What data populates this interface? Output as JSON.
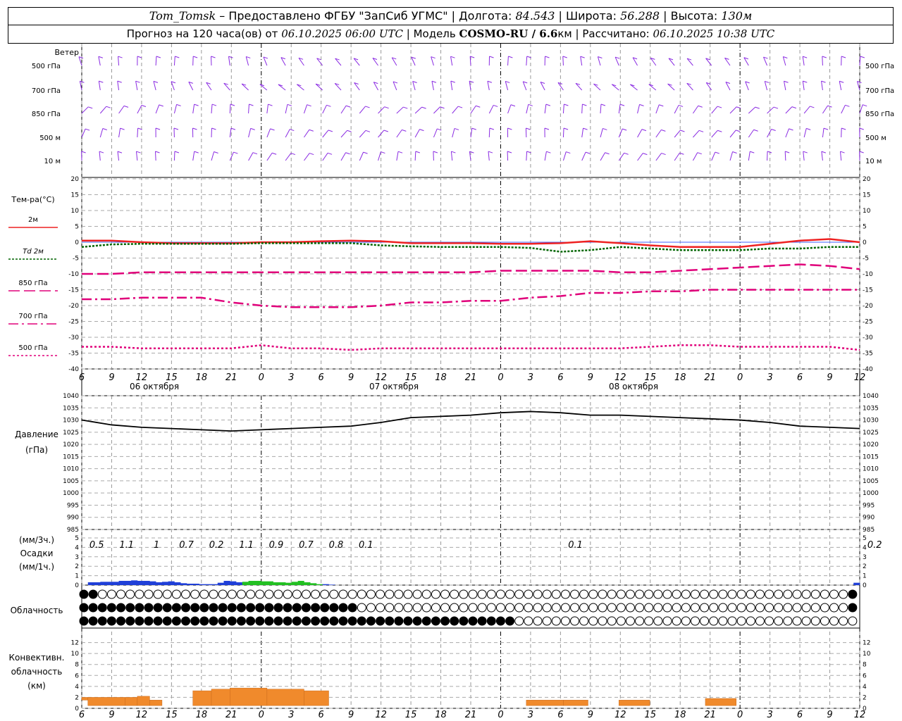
{
  "header": {
    "station": "Tom_Tomsk",
    "provider": "– Предоставлено ФГБУ \"ЗапСиб УГМС\"",
    "lon_label": "Долгота:",
    "lon": "84.543",
    "lat_label": "Широта:",
    "lat": "56.288",
    "alt_label": "Высота:",
    "alt": "130м",
    "forecast_label": "Прогноз на 120 часа(ов) от",
    "forecast_start": "06.10.2025 06:00 UTC",
    "model_label": "Модель",
    "model": "COSMO-RU / 6.6",
    "model_unit": "км",
    "calc_label": "Рассчитано:",
    "calc_time": "06.10.2025 10:38 UTC"
  },
  "labels": {
    "wind": "Ветер",
    "wind_levels": [
      "500 гПа",
      "700 гПа",
      "850 гПа",
      "500 м",
      "10 м"
    ],
    "temp": "Тем-ра(°С)",
    "pressure1": "Давление",
    "pressure2": "(гПа)",
    "precip1": "(мм/3ч.)",
    "precip2": "Осадки",
    "precip3": "(мм/1ч.)",
    "cloud": "Облачность",
    "conv1": "Конвективн.",
    "conv2": "облачность",
    "conv3": "(км)"
  },
  "colors": {
    "wind": "#8a2be2",
    "t2m": "#ee2222",
    "td2m": "#006400",
    "t850": "#e0007a",
    "t700": "#e0007a",
    "t500": "#e0007a",
    "pressure": "#000000",
    "rain": "#1f3fd8",
    "rain2": "#22c022",
    "conv": "#f08a2c"
  },
  "chart_data": {
    "type": "line",
    "x_ticks": [
      "6",
      "9",
      "12",
      "15",
      "18",
      "21",
      "0",
      "3",
      "6",
      "9",
      "12",
      "15",
      "18",
      "21",
      "0",
      "3",
      "6",
      "9",
      "12",
      "15",
      "18",
      "21",
      "0",
      "3",
      "6",
      "9",
      "12"
    ],
    "date_labels": [
      "06 октября",
      "07 октября",
      "08 октября"
    ],
    "temperature": {
      "ylim": [
        -40,
        20
      ],
      "yticks": [
        20,
        15,
        10,
        5,
        0,
        -5,
        -10,
        -15,
        -20,
        -25,
        -30,
        -35,
        -40
      ],
      "series": [
        {
          "name": "2м",
          "values": [
            0.5,
            0.5,
            0,
            -0.3,
            -0.3,
            -0.3,
            0,
            0,
            0.3,
            0.5,
            0.3,
            -0.3,
            -0.3,
            -0.3,
            -0.5,
            -0.5,
            -0.3,
            0.3,
            -0.3,
            -1,
            -1.5,
            -1.5,
            -1.5,
            -0.5,
            0.5,
            1,
            0
          ]
        },
        {
          "name": "Td 2м",
          "values": [
            -1.5,
            -0.7,
            -0.5,
            -0.5,
            -0.5,
            -0.5,
            -0.3,
            -0.3,
            -0.3,
            -0.3,
            -1,
            -1.3,
            -1.5,
            -1.5,
            -1.5,
            -1.8,
            -3,
            -2.5,
            -1.5,
            -2,
            -2.5,
            -2.5,
            -2.5,
            -2,
            -2,
            -1.5,
            -1.5
          ]
        },
        {
          "name": "850 гПа",
          "values": [
            -10,
            -10,
            -9.5,
            -9.5,
            -9.5,
            -9.5,
            -9.5,
            -9.5,
            -9.5,
            -9.5,
            -9.5,
            -9.5,
            -9.5,
            -9.5,
            -9,
            -9,
            -9,
            -9,
            -9.5,
            -9.5,
            -9,
            -8.5,
            -8,
            -7.5,
            -7,
            -7.5,
            -8.5
          ]
        },
        {
          "name": "700 гПа",
          "values": [
            -18,
            -18,
            -17.5,
            -17.5,
            -17.5,
            -19,
            -20,
            -20.5,
            -20.5,
            -20.5,
            -20,
            -19,
            -19,
            -18.5,
            -18.5,
            -17.5,
            -17,
            -16,
            -16,
            -15.5,
            -15.5,
            -15,
            -15,
            -15,
            -15,
            -15,
            -15
          ]
        },
        {
          "name": "500 гПа",
          "values": [
            -33,
            -33,
            -33.5,
            -33.5,
            -33.5,
            -33.5,
            -32.5,
            -33.5,
            -33.5,
            -34,
            -33.5,
            -33.5,
            -33.5,
            -33.5,
            -33.5,
            -33.5,
            -33.5,
            -33.5,
            -33.5,
            -33,
            -32.5,
            -32.5,
            -33,
            -33,
            -33,
            -33,
            -34
          ]
        }
      ]
    },
    "pressure": {
      "ylim": [
        985,
        1040
      ],
      "yticks": [
        1040,
        1035,
        1030,
        1025,
        1020,
        1015,
        1010,
        1005,
        1000,
        995,
        990,
        985
      ],
      "values": [
        1030,
        1028,
        1027,
        1026.5,
        1026,
        1025.5,
        1026,
        1026.5,
        1027,
        1027.5,
        1029,
        1031,
        1031.5,
        1032,
        1033,
        1033.5,
        1033,
        1032,
        1032,
        1031.5,
        1031,
        1030.5,
        1030,
        1029,
        1027.5,
        1027,
        1026.5
      ]
    },
    "precipitation": {
      "ylim": [
        0,
        5
      ],
      "yticks": [
        5,
        4,
        3,
        2,
        1,
        0
      ],
      "totals_3h": [
        "0.5",
        "1.1",
        "1",
        "0.7",
        "0.2",
        "1.1",
        "0.9",
        "0.7",
        "0.8",
        "0.1",
        "",
        "",
        "",
        "",
        "",
        "",
        "0.1",
        "",
        "",
        "",
        "",
        "",
        "",
        "",
        "",
        "",
        "0.2"
      ],
      "hourly": [
        0,
        0.3,
        0.3,
        0.35,
        0.35,
        0.35,
        0.45,
        0.45,
        0.5,
        0.45,
        0.45,
        0.4,
        0.3,
        0.35,
        0.4,
        0.3,
        0.2,
        0.15,
        0.15,
        0.1,
        0.1,
        0.1,
        0.25,
        0.45,
        0.4,
        0.3,
        0.35,
        0.45,
        0.45,
        0.4,
        0.4,
        0.3,
        0.3,
        0.25,
        0.35,
        0.45,
        0.3,
        0.2,
        0.1,
        0.1,
        0.05,
        0,
        0,
        0,
        0,
        0,
        0,
        0,
        0,
        0,
        0,
        0,
        0,
        0,
        0,
        0,
        0,
        0,
        0,
        0,
        0,
        0,
        0,
        0,
        0,
        0,
        0,
        0,
        0,
        0,
        0,
        0,
        0,
        0,
        0,
        0,
        0,
        0,
        0,
        0,
        0,
        0,
        0,
        0,
        0,
        0,
        0,
        0,
        0,
        0,
        0,
        0,
        0,
        0,
        0,
        0,
        0,
        0,
        0,
        0,
        0,
        0,
        0,
        0,
        0,
        0,
        0,
        0,
        0,
        0,
        0,
        0,
        0,
        0,
        0,
        0,
        0,
        0,
        0,
        0,
        0,
        0,
        0,
        0,
        0,
        0.25
      ],
      "green_hours": [
        26,
        27,
        28,
        29,
        30,
        31,
        32,
        33,
        34,
        35,
        36,
        37,
        38
      ]
    },
    "cloud_rows": 3,
    "convective": {
      "ylim": [
        0,
        14
      ],
      "yticks": [
        12,
        10,
        8,
        6,
        4,
        2,
        0
      ],
      "segments": [
        {
          "x0": 0,
          "x1": 1,
          "base": 1.5,
          "top": 2
        },
        {
          "x0": 1,
          "x1": 7,
          "base": 0.5,
          "top": 2
        },
        {
          "x0": 7,
          "x1": 9,
          "base": 0.5,
          "top": 2
        },
        {
          "x0": 9,
          "x1": 11,
          "base": 0.5,
          "top": 2.2
        },
        {
          "x0": 11,
          "x1": 13,
          "base": 0.5,
          "top": 1.5
        },
        {
          "x0": 13,
          "x1": 15,
          "base": 0.5,
          "top": 0.5
        },
        {
          "x0": 18,
          "x1": 21,
          "base": 0.5,
          "top": 3.2
        },
        {
          "x0": 21,
          "x1": 24,
          "base": 0.5,
          "top": 3.5
        },
        {
          "x0": 24,
          "x1": 30,
          "base": 0.5,
          "top": 3.7
        },
        {
          "x0": 30,
          "x1": 36,
          "base": 0.5,
          "top": 3.5
        },
        {
          "x0": 36,
          "x1": 40,
          "base": 0.5,
          "top": 3.2
        },
        {
          "x0": 64,
          "x1": 67,
          "base": 0.5,
          "top": 0.5
        },
        {
          "x0": 72,
          "x1": 78,
          "base": 0.5,
          "top": 1.5
        },
        {
          "x0": 78,
          "x1": 82,
          "base": 0.5,
          "top": 1.5
        },
        {
          "x0": 87,
          "x1": 92,
          "base": 0.5,
          "top": 1.5
        },
        {
          "x0": 101,
          "x1": 106,
          "base": 0.5,
          "top": 1.8
        }
      ]
    }
  }
}
